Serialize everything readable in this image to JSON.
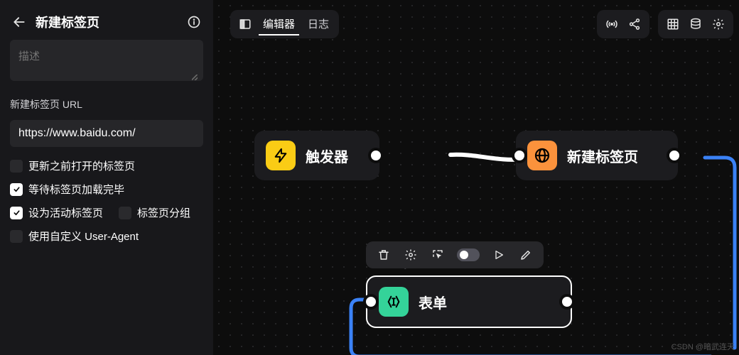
{
  "sidebar": {
    "title": "新建标签页",
    "desc_placeholder": "描述",
    "url_label": "新建标签页 URL",
    "url_value": "https://www.baidu.com/",
    "checks": {
      "update_prev": {
        "label": "更新之前打开的标签页",
        "checked": false
      },
      "wait_load": {
        "label": "等待标签页加载完毕",
        "checked": true
      },
      "set_active": {
        "label": "设为活动标签页",
        "checked": true
      },
      "tab_group": {
        "label": "标签页分组",
        "checked": false
      },
      "custom_ua": {
        "label": "使用自定义 User-Agent",
        "checked": false
      }
    }
  },
  "tabs": {
    "editor": "编辑器",
    "log": "日志",
    "active": "editor"
  },
  "nodes": {
    "trigger": {
      "label": "触发器"
    },
    "new_tab": {
      "label": "新建标签页"
    },
    "form": {
      "label": "表单",
      "id": "9mvqnf3"
    }
  },
  "watermark": "CSDN @暗武连天"
}
